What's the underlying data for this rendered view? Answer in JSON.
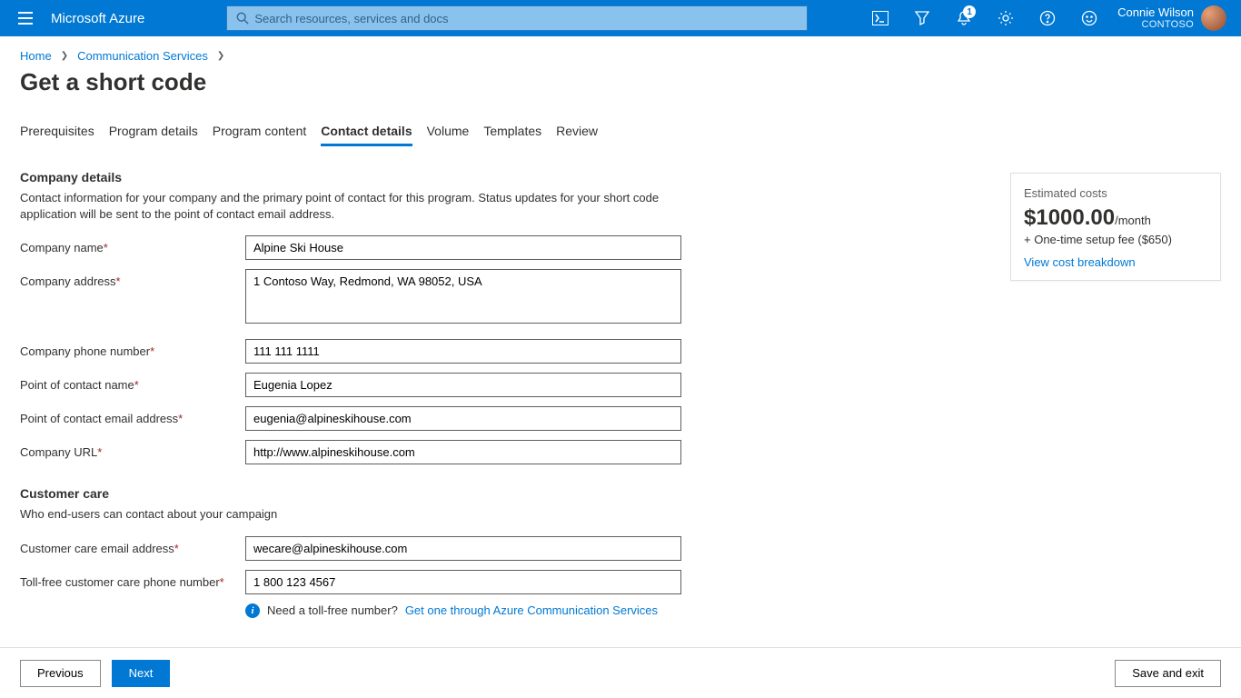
{
  "header": {
    "brand": "Microsoft Azure",
    "search_placeholder": "Search resources, services and docs",
    "notification_count": "1",
    "user_name": "Connie Wilson",
    "user_org": "CONTOSO"
  },
  "breadcrumb": {
    "home": "Home",
    "service": "Communication Services"
  },
  "page_title": "Get a short code",
  "tabs": {
    "prereq": "Prerequisites",
    "program_details": "Program details",
    "program_content": "Program content",
    "contact_details": "Contact details",
    "volume": "Volume",
    "templates": "Templates",
    "review": "Review"
  },
  "section_company": {
    "title": "Company details",
    "desc": "Contact information for your company and the primary point of contact for this program. Status updates for your short code application will be sent to the point of contact email address.",
    "labels": {
      "company_name": "Company name",
      "company_address": "Company address",
      "company_phone": "Company phone number",
      "contact_name": "Point of contact name",
      "contact_email": "Point of contact email address",
      "company_url": "Company URL"
    },
    "values": {
      "company_name": "Alpine Ski House",
      "company_address": "1 Contoso Way, Redmond, WA 98052, USA",
      "company_phone": "111 111 1111",
      "contact_name": "Eugenia Lopez",
      "contact_email": "eugenia@alpineskihouse.com",
      "company_url": "http://www.alpineskihouse.com"
    }
  },
  "section_care": {
    "title": "Customer care",
    "desc": "Who end-users can contact about your campaign",
    "labels": {
      "care_email": "Customer care email address",
      "care_phone": "Toll-free customer care phone number"
    },
    "values": {
      "care_email": "wecare@alpineskihouse.com",
      "care_phone": "1 800 123 4567"
    },
    "tollfree_prompt": "Need a toll-free number?",
    "tollfree_link": "Get one through Azure Communication Services"
  },
  "cost_box": {
    "heading": "Estimated costs",
    "amount": "$1000.00",
    "unit": "/month",
    "setup": "+ One-time setup fee ($650)",
    "link": "View cost breakdown"
  },
  "footer": {
    "previous": "Previous",
    "next": "Next",
    "save": "Save and exit"
  }
}
